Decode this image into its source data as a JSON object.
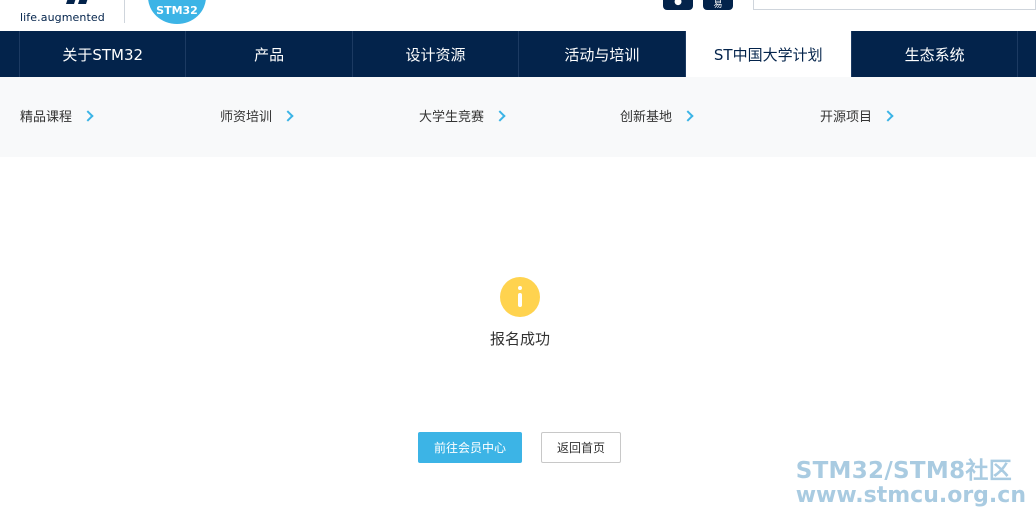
{
  "header": {
    "tagline": "life.augmented",
    "badge": "STM32",
    "top_links": [
      "i",
      "t",
      "i",
      "i"
    ],
    "search_placeholder": ""
  },
  "nav": {
    "items": [
      {
        "label": "关于STM32"
      },
      {
        "label": "产品"
      },
      {
        "label": "设计资源"
      },
      {
        "label": "活动与培训"
      },
      {
        "label": "ST中国大学计划"
      },
      {
        "label": "生态系统"
      }
    ],
    "active_index": 4
  },
  "subnav": {
    "items": [
      {
        "label": "精品课程"
      },
      {
        "label": "师资培训"
      },
      {
        "label": "大学生竞赛"
      },
      {
        "label": "创新基地"
      },
      {
        "label": "开源项目"
      }
    ]
  },
  "content": {
    "message": "报名成功",
    "primary_button": "前往会员中心",
    "secondary_button": "返回首页"
  },
  "watermark": {
    "line1": "STM32/STM8社区",
    "line2": "www.stmcu.org.cn"
  },
  "colors": {
    "nav_bg": "#03234b",
    "accent": "#3cb4e6",
    "info_icon": "#ffd34f"
  }
}
